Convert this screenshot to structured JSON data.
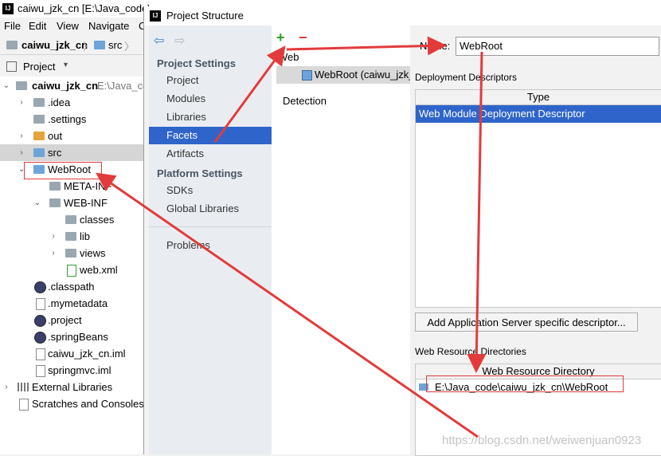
{
  "ide": {
    "window_title": "caiwu_jzk_cn [E:\\Java_code\\",
    "logo": "IJ",
    "menu": [
      "File",
      "Edit",
      "View",
      "Navigate",
      "C"
    ],
    "breadcrumbs": [
      "caiwu_jzk_cn",
      "src"
    ],
    "project_view_label": "Project",
    "tree": [
      {
        "label": "caiwu_jzk_cn",
        "extra": "E:\\Java_co",
        "bold": true
      },
      {
        "label": ".idea"
      },
      {
        "label": ".settings"
      },
      {
        "label": "out"
      },
      {
        "label": "src"
      },
      {
        "label": "WebRoot"
      },
      {
        "label": "META-INF"
      },
      {
        "label": "WEB-INF"
      },
      {
        "label": "classes"
      },
      {
        "label": "lib"
      },
      {
        "label": "views"
      },
      {
        "label": "web.xml"
      },
      {
        "label": ".classpath"
      },
      {
        "label": ".mymetadata"
      },
      {
        "label": ".project"
      },
      {
        "label": ".springBeans"
      },
      {
        "label": "caiwu_jzk_cn.iml"
      },
      {
        "label": "springmvc.iml"
      },
      {
        "label": "External Libraries"
      },
      {
        "label": "Scratches and Consoles"
      }
    ]
  },
  "dialog": {
    "title": "Project Structure",
    "logo": "IJ",
    "nav": {
      "project_settings_header": "Project Settings",
      "project_settings_items": [
        "Project",
        "Modules",
        "Libraries",
        "Facets",
        "Artifacts"
      ],
      "platform_settings_header": "Platform Settings",
      "platform_settings_items": [
        "SDKs",
        "Global Libraries"
      ],
      "problems": "Problems",
      "selected": "Facets"
    },
    "facets": {
      "add_symbol": "+",
      "remove_symbol": "−",
      "group": "Web",
      "item": "WebRoot (caiwu_jzk_",
      "detection": "Detection"
    },
    "name_label": "Name:",
    "name_value": "WebRoot",
    "deployment_descriptors_label": "Deployment Descriptors",
    "dd_column": "Type",
    "dd_row": "Web Module Deployment Descriptor",
    "add_server_button": "Add Application Server specific descriptor...",
    "web_resource_dirs_label": "Web Resource Directories",
    "wrd_column": "Web Resource Directory",
    "wrd_row": "E:\\Java_code\\caiwu_jzk_cn\\WebRoot"
  },
  "watermark": "https://blog.csdn.net/weiwenjuan0923",
  "colors": {
    "selection": "#2f65ca",
    "annotation_red": "#e23b3b",
    "add_green": "#2aa12a",
    "remove_red": "#d43b3b"
  }
}
